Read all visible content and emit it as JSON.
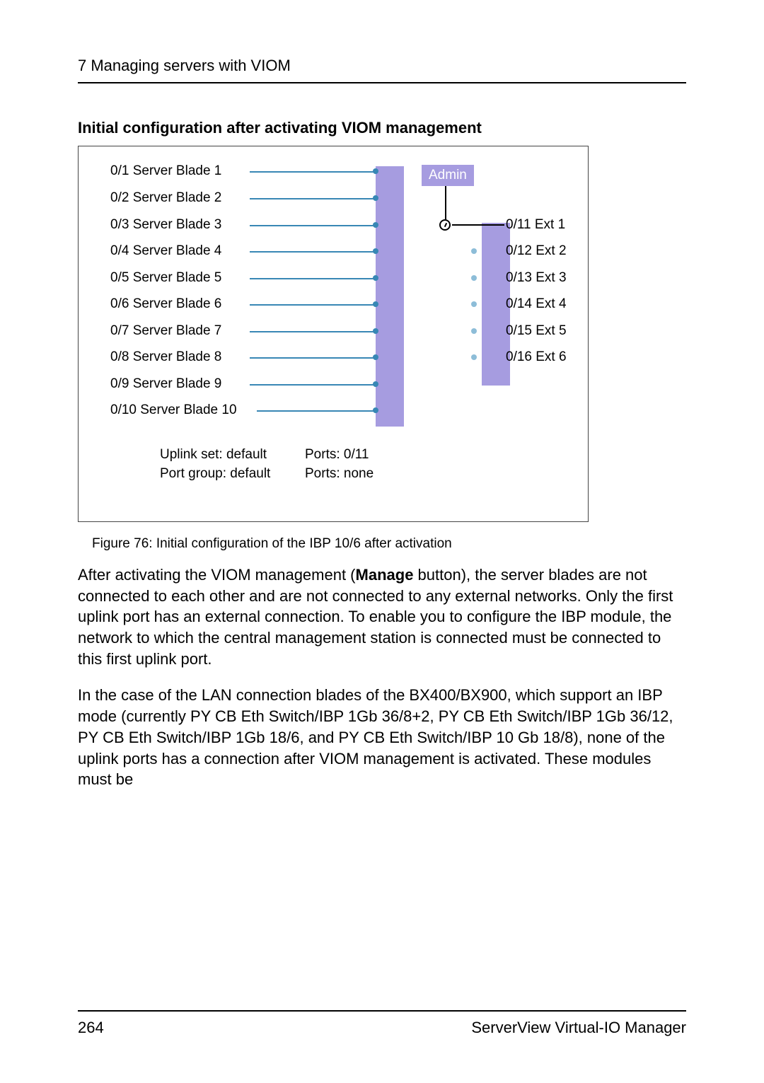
{
  "header": "7 Managing servers with VIOM",
  "section_title": "Initial configuration after activating VIOM management",
  "figure": {
    "blades": [
      "0/1 Server Blade 1",
      "0/2 Server Blade 2",
      "0/3 Server Blade 3",
      "0/4 Server Blade 4",
      "0/5 Server Blade 5",
      "0/6 Server Blade 6",
      "0/7 Server Blade 7",
      "0/8 Server Blade 8",
      "0/9 Server Blade 9",
      "0/10 Server Blade 10"
    ],
    "admin": "Admin",
    "externals": [
      "0/11 Ext 1",
      "0/12 Ext 2",
      "0/13 Ext 3",
      "0/14 Ext 4",
      "0/15 Ext 5",
      "0/16 Ext 6"
    ],
    "uplink_set_label": "Uplink set: default",
    "uplink_set_ports": "Ports: 0/11",
    "port_group_label": "Port group: default",
    "port_group_ports": "Ports: none"
  },
  "figure_caption": "Figure 76: Initial configuration of the IBP 10/6 after activation",
  "para1_a": "After activating the VIOM management (",
  "para1_b": "Manage",
  "para1_c": " button), the server blades are not connected to each other and are not connected to any external networks. Only the first uplink port has an external connection. To enable you to configure the IBP module, the network to which the central management station is connected must be connected to this first uplink port.",
  "para2": "In the case of the LAN connection blades of the BX400/BX900, which support an IBP mode (currently PY CB Eth Switch/IBP 1Gb 36/8+2, PY CB Eth Switch/IBP 1Gb 36/12, PY CB Eth Switch/IBP 1Gb 18/6, and PY CB Eth Switch/IBP 10 Gb 18/8), none of the uplink ports has a connection after VIOM management is activated. These modules must be",
  "footer_left": "264",
  "footer_right": "ServerView Virtual-IO Manager"
}
